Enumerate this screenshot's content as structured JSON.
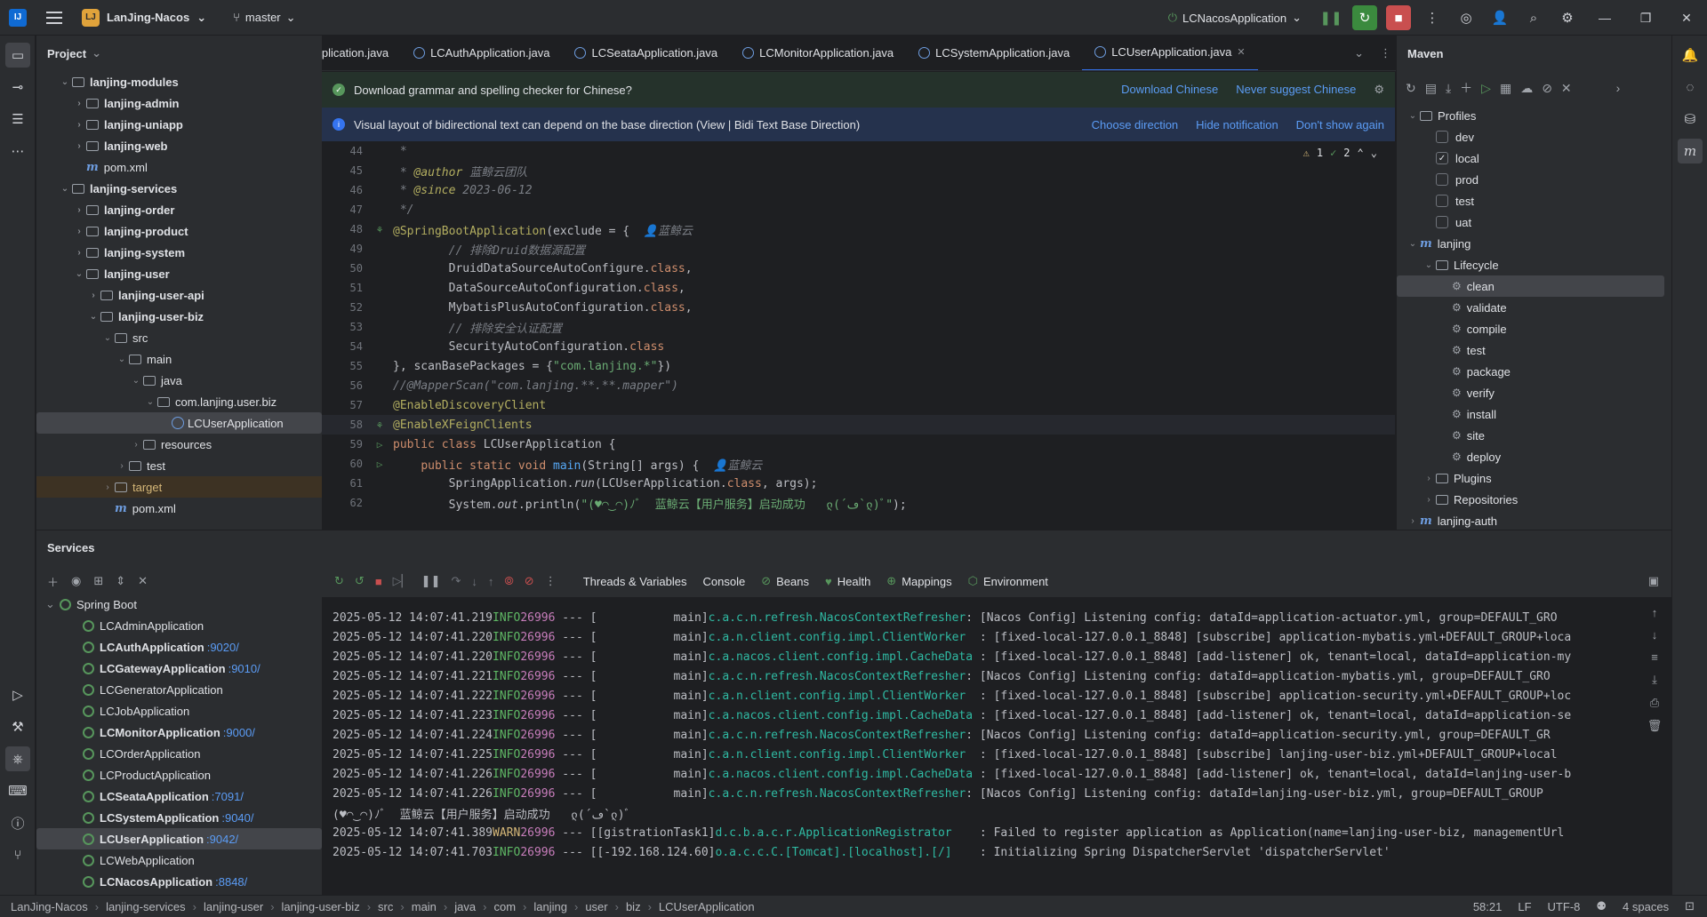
{
  "titlebar": {
    "project_badge": "LJ",
    "project": "LanJing-Nacos",
    "branch": "master",
    "run_config": "LCNacosApplication"
  },
  "project_panel": {
    "title": "Project",
    "rows": [
      {
        "label": "lanjing-modules",
        "indent": 1,
        "arrow": "v",
        "icon": "folder",
        "bold": true
      },
      {
        "label": "lanjing-admin",
        "indent": 2,
        "arrow": ">",
        "icon": "folder",
        "bold": true
      },
      {
        "label": "lanjing-uniapp",
        "indent": 2,
        "arrow": ">",
        "icon": "folder",
        "bold": true
      },
      {
        "label": "lanjing-web",
        "indent": 2,
        "arrow": ">",
        "icon": "folder",
        "bold": true
      },
      {
        "label": "pom.xml",
        "indent": 2,
        "arrow": "",
        "icon": "maven",
        "bold": false
      },
      {
        "label": "lanjing-services",
        "indent": 1,
        "arrow": "v",
        "icon": "folder",
        "bold": true
      },
      {
        "label": "lanjing-order",
        "indent": 2,
        "arrow": ">",
        "icon": "folder",
        "bold": true
      },
      {
        "label": "lanjing-product",
        "indent": 2,
        "arrow": ">",
        "icon": "folder",
        "bold": true
      },
      {
        "label": "lanjing-system",
        "indent": 2,
        "arrow": ">",
        "icon": "folder",
        "bold": true
      },
      {
        "label": "lanjing-user",
        "indent": 2,
        "arrow": "v",
        "icon": "folder",
        "bold": true
      },
      {
        "label": "lanjing-user-api",
        "indent": 3,
        "arrow": ">",
        "icon": "folder",
        "bold": true
      },
      {
        "label": "lanjing-user-biz",
        "indent": 3,
        "arrow": "v",
        "icon": "folder",
        "bold": true
      },
      {
        "label": "src",
        "indent": 4,
        "arrow": "v",
        "icon": "folder",
        "bold": false
      },
      {
        "label": "main",
        "indent": 5,
        "arrow": "v",
        "icon": "folder",
        "bold": false
      },
      {
        "label": "java",
        "indent": 6,
        "arrow": "v",
        "icon": "folder",
        "bold": false
      },
      {
        "label": "com.lanjing.user.biz",
        "indent": 7,
        "arrow": "v",
        "icon": "folder",
        "bold": false
      },
      {
        "label": "LCUserApplication",
        "indent": 8,
        "arrow": "",
        "icon": "class",
        "bold": false,
        "selected": true
      },
      {
        "label": "resources",
        "indent": 6,
        "arrow": ">",
        "icon": "folder",
        "bold": false
      },
      {
        "label": "test",
        "indent": 5,
        "arrow": ">",
        "icon": "folder",
        "bold": false
      },
      {
        "label": "target",
        "indent": 4,
        "arrow": ">",
        "icon": "folder",
        "bold": false,
        "target": true
      },
      {
        "label": "pom.xml",
        "indent": 4,
        "arrow": "",
        "icon": "maven",
        "bold": false
      }
    ]
  },
  "editor": {
    "tabs": [
      {
        "label": "Application.java",
        "active": false
      },
      {
        "label": "LCAuthApplication.java",
        "active": false
      },
      {
        "label": "LCSeataApplication.java",
        "active": false
      },
      {
        "label": "LCMonitorApplication.java",
        "active": false
      },
      {
        "label": "LCSystemApplication.java",
        "active": false
      },
      {
        "label": "LCUserApplication.java",
        "active": true
      }
    ],
    "notif_grammar": {
      "text": "Download grammar and spelling checker for Chinese?",
      "link1": "Download Chinese",
      "link2": "Never suggest Chinese"
    },
    "notif_bidi": {
      "text": "Visual layout of bidirectional text can depend on the base direction (View | Bidi Text Base Direction)",
      "link1": "Choose direction",
      "link2": "Hide notification",
      "link3": "Don't show again"
    },
    "inspection": {
      "warnings": "1",
      "checks": "2"
    },
    "lines": [
      {
        "n": "44",
        "html": " <span class='cmt'>*</span>"
      },
      {
        "n": "45",
        "html": " <span class='cmt'>* <span class='ann'>@author</span> 蓝鲸云团队</span>"
      },
      {
        "n": "46",
        "html": " <span class='cmt'>* <span class='ann'>@since</span> 2023-06-12</span>"
      },
      {
        "n": "47",
        "html": " <span class='cmt'>*/</span>"
      },
      {
        "n": "48",
        "html": "<span class='ann'>@SpringBootApplication</span>(exclude = {  <span class='cmt'>👤蓝鲸云</span>",
        "gutter": "bean"
      },
      {
        "n": "49",
        "html": "        <span class='cmt'>// 排除Druid数据源配置</span>"
      },
      {
        "n": "50",
        "html": "        DruidDataSourceAutoConfigure.<span class='kw'>class</span>,"
      },
      {
        "n": "51",
        "html": "        DataSourceAutoConfiguration.<span class='kw'>class</span>,"
      },
      {
        "n": "52",
        "html": "        MybatisPlusAutoConfiguration.<span class='kw'>class</span>,"
      },
      {
        "n": "53",
        "html": "        <span class='cmt'>// 排除安全认证配置</span>"
      },
      {
        "n": "54",
        "html": "        SecurityAutoConfiguration.<span class='kw'>class</span>"
      },
      {
        "n": "55",
        "html": "}, scanBasePackages = {<span class='str'>\"com.lanjing.*\"</span>})"
      },
      {
        "n": "56",
        "html": "<span class='cmt'>//@MapperScan(\"com.lanjing.**.**.mapper\")</span>"
      },
      {
        "n": "57",
        "html": "<span class='ann'>@EnableDiscoveryClient</span>"
      },
      {
        "n": "58",
        "html": "<span class='ann'>@EnableXFeignClients</span>",
        "gutter": "bean",
        "current": true
      },
      {
        "n": "59",
        "html": "<span class='kw'>public class</span> LCUserApplication {",
        "gutter": "run"
      },
      {
        "n": "60",
        "html": "    <span class='kw'>public static void</span> <span class='fn'>main</span>(String[] args) {  <span class='cmt'>👤蓝鲸云</span>",
        "gutter": "run"
      },
      {
        "n": "61",
        "html": "        SpringApplication.<span class='it'>run</span>(LCUserApplication.<span class='kw'>class</span>, args);"
      },
      {
        "n": "62",
        "html": "        System.<span class='it'>out</span>.println(<span class='str'>\"(♥◠‿◠)ﾉﾞ  蓝鲸云【用户服务】启动成功   ლ(´ڡ`ლ)ﾞ\"</span>);"
      }
    ]
  },
  "maven": {
    "title": "Maven",
    "rows": [
      {
        "label": "Profiles",
        "indent": 1,
        "arrow": "v",
        "kind": "folder"
      },
      {
        "label": "dev",
        "indent": 2,
        "kind": "check",
        "checked": false
      },
      {
        "label": "local",
        "indent": 2,
        "kind": "check",
        "checked": true
      },
      {
        "label": "prod",
        "indent": 2,
        "kind": "check",
        "checked": false
      },
      {
        "label": "test",
        "indent": 2,
        "kind": "check",
        "checked": false
      },
      {
        "label": "uat",
        "indent": 2,
        "kind": "check",
        "checked": false
      },
      {
        "label": "lanjing",
        "indent": 1,
        "arrow": "v",
        "kind": "maven"
      },
      {
        "label": "Lifecycle",
        "indent": 2,
        "arrow": "v",
        "kind": "folder"
      },
      {
        "label": "clean",
        "indent": 3,
        "kind": "goal",
        "selected": true
      },
      {
        "label": "validate",
        "indent": 3,
        "kind": "goal"
      },
      {
        "label": "compile",
        "indent": 3,
        "kind": "goal"
      },
      {
        "label": "test",
        "indent": 3,
        "kind": "goal"
      },
      {
        "label": "package",
        "indent": 3,
        "kind": "goal"
      },
      {
        "label": "verify",
        "indent": 3,
        "kind": "goal"
      },
      {
        "label": "install",
        "indent": 3,
        "kind": "goal"
      },
      {
        "label": "site",
        "indent": 3,
        "kind": "goal"
      },
      {
        "label": "deploy",
        "indent": 3,
        "kind": "goal"
      },
      {
        "label": "Plugins",
        "indent": 2,
        "arrow": ">",
        "kind": "folder"
      },
      {
        "label": "Repositories",
        "indent": 2,
        "arrow": ">",
        "kind": "folder"
      },
      {
        "label": "lanjing-auth",
        "indent": 1,
        "arrow": ">",
        "kind": "maven"
      }
    ]
  },
  "services": {
    "title": "Services",
    "group": "Spring Boot",
    "apps": [
      {
        "name": "LCAdminApplication",
        "port": "",
        "running": false
      },
      {
        "name": "LCAuthApplication",
        "port": ":9020/",
        "running": true
      },
      {
        "name": "LCGatewayApplication",
        "port": ":9010/",
        "running": true
      },
      {
        "name": "LCGeneratorApplication",
        "port": "",
        "running": false
      },
      {
        "name": "LCJobApplication",
        "port": "",
        "running": false
      },
      {
        "name": "LCMonitorApplication",
        "port": ":9000/",
        "running": true
      },
      {
        "name": "LCOrderApplication",
        "port": "",
        "running": false
      },
      {
        "name": "LCProductApplication",
        "port": "",
        "running": false
      },
      {
        "name": "LCSeataApplication",
        "port": ":7091/",
        "running": true
      },
      {
        "name": "LCSystemApplication",
        "port": ":9040/",
        "running": true
      },
      {
        "name": "LCUserApplication",
        "port": ":9042/",
        "running": true,
        "selected": true
      },
      {
        "name": "LCWebApplication",
        "port": "",
        "running": false
      },
      {
        "name": "LCNacosApplication",
        "port": ":8848/",
        "running": true
      }
    ],
    "console_tabs": [
      "Threads & Variables",
      "Console",
      "Beans",
      "Health",
      "Mappings",
      "Environment"
    ],
    "logs": [
      {
        "ts": "2025-05-12 14:07:41.219",
        "lvl": "INFO",
        "pid": "26996",
        "thread": "           main]",
        "logger": "c.a.c.n.refresh.NacosContextRefresher",
        "msg": ": [Nacos Config] Listening config: dataId=application-actuator.yml, group=DEFAULT_GRO"
      },
      {
        "ts": "2025-05-12 14:07:41.220",
        "lvl": "INFO",
        "pid": "26996",
        "thread": "           main]",
        "logger": "c.a.n.client.config.impl.ClientWorker  ",
        "msg": ": [fixed-local-127.0.0.1_8848] [subscribe] application-mybatis.yml+DEFAULT_GROUP+loca"
      },
      {
        "ts": "2025-05-12 14:07:41.220",
        "lvl": "INFO",
        "pid": "26996",
        "thread": "           main]",
        "logger": "c.a.nacos.client.config.impl.CacheData ",
        "msg": ": [fixed-local-127.0.0.1_8848] [add-listener] ok, tenant=local, dataId=application-my"
      },
      {
        "ts": "2025-05-12 14:07:41.221",
        "lvl": "INFO",
        "pid": "26996",
        "thread": "           main]",
        "logger": "c.a.c.n.refresh.NacosContextRefresher",
        "msg": ": [Nacos Config] Listening config: dataId=application-mybatis.yml, group=DEFAULT_GRO"
      },
      {
        "ts": "2025-05-12 14:07:41.222",
        "lvl": "INFO",
        "pid": "26996",
        "thread": "           main]",
        "logger": "c.a.n.client.config.impl.ClientWorker  ",
        "msg": ": [fixed-local-127.0.0.1_8848] [subscribe] application-security.yml+DEFAULT_GROUP+loc"
      },
      {
        "ts": "2025-05-12 14:07:41.223",
        "lvl": "INFO",
        "pid": "26996",
        "thread": "           main]",
        "logger": "c.a.nacos.client.config.impl.CacheData ",
        "msg": ": [fixed-local-127.0.0.1_8848] [add-listener] ok, tenant=local, dataId=application-se"
      },
      {
        "ts": "2025-05-12 14:07:41.224",
        "lvl": "INFO",
        "pid": "26996",
        "thread": "           main]",
        "logger": "c.a.c.n.refresh.NacosContextRefresher",
        "msg": ": [Nacos Config] Listening config: dataId=application-security.yml, group=DEFAULT_GR"
      },
      {
        "ts": "2025-05-12 14:07:41.225",
        "lvl": "INFO",
        "pid": "26996",
        "thread": "           main]",
        "logger": "c.a.n.client.config.impl.ClientWorker  ",
        "msg": ": [fixed-local-127.0.0.1_8848] [subscribe] lanjing-user-biz.yml+DEFAULT_GROUP+local"
      },
      {
        "ts": "2025-05-12 14:07:41.226",
        "lvl": "INFO",
        "pid": "26996",
        "thread": "           main]",
        "logger": "c.a.nacos.client.config.impl.CacheData ",
        "msg": ": [fixed-local-127.0.0.1_8848] [add-listener] ok, tenant=local, dataId=lanjing-user-b"
      },
      {
        "ts": "2025-05-12 14:07:41.226",
        "lvl": "INFO",
        "pid": "26996",
        "thread": "           main]",
        "logger": "c.a.c.n.refresh.NacosContextRefresher",
        "msg": ": [Nacos Config] Listening config: dataId=lanjing-user-biz.yml, group=DEFAULT_GROUP"
      },
      {
        "plain": "(♥◠‿◠)ﾉﾞ  蓝鲸云【用户服务】启动成功   ლ(´ڡ`ლ)ﾞ"
      },
      {
        "ts": "2025-05-12 14:07:41.389",
        "lvl": "WARN",
        "pid": "26996",
        "thread": "[gistrationTask1]",
        "logger": "d.c.b.a.c.r.ApplicationRegistrator    ",
        "msg": ": Failed to register application as Application(name=lanjing-user-biz, managementUrl"
      },
      {
        "ts": "2025-05-12 14:07:41.703",
        "lvl": "INFO",
        "pid": "26996",
        "thread": "[-192.168.124.60]",
        "logger": "o.a.c.c.C.[Tomcat].[localhost].[/]    ",
        "msg": ": Initializing Spring DispatcherServlet 'dispatcherServlet'"
      }
    ]
  },
  "statusbar": {
    "crumbs": [
      "LanJing-Nacos",
      "lanjing-services",
      "lanjing-user",
      "lanjing-user-biz",
      "src",
      "main",
      "java",
      "com",
      "lanjing",
      "user",
      "biz",
      "LCUserApplication"
    ],
    "position": "58:21",
    "line_sep": "LF",
    "encoding": "UTF-8",
    "indent": "4 spaces"
  }
}
